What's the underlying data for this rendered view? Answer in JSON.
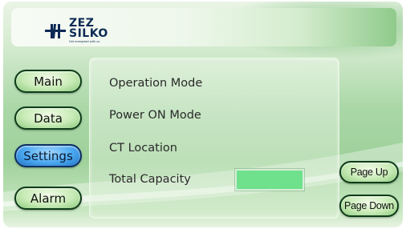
{
  "header": {
    "logo_line1": "ZEZ",
    "logo_line2": "SILKO",
    "logo_tagline": "Get energized with us"
  },
  "nav": {
    "items": [
      {
        "label": "Main",
        "active": false
      },
      {
        "label": "Data",
        "active": false
      },
      {
        "label": "Settings",
        "active": true
      },
      {
        "label": "Alarm",
        "active": false
      }
    ]
  },
  "settings": {
    "operation_mode_label": "Operation Mode",
    "power_on_mode_label": "Power ON Mode",
    "ct_location_label": "CT Location",
    "total_capacity_label": "Total Capacity",
    "total_capacity_value": ""
  },
  "paging": {
    "page_up_label": "Page Up",
    "page_down_label": "Page Down"
  },
  "colors": {
    "background_green": "#a9d7a6",
    "button_dark_border": "#0d3d18",
    "active_button_blue": "#4aa8f0",
    "input_field_green": "#6fe08c",
    "logo_navy": "#0d2a55"
  }
}
